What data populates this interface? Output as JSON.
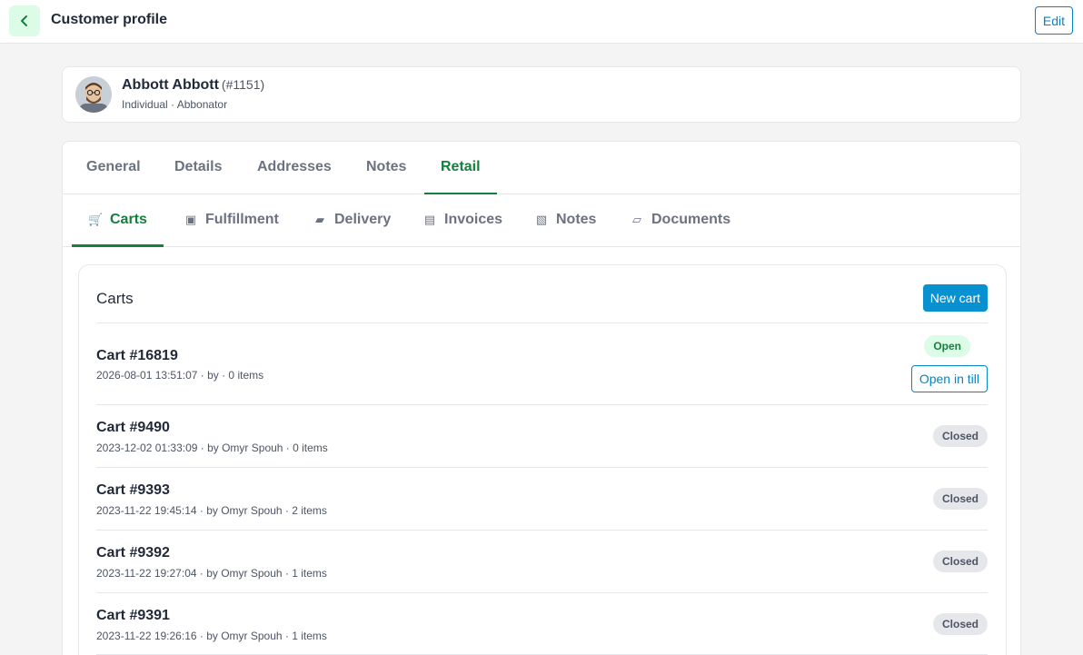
{
  "header": {
    "title": "Customer profile",
    "edit_label": "Edit"
  },
  "profile": {
    "name": "Abbott Abbott",
    "id": "(#1151)",
    "subtitle": "Individual · Abbonator"
  },
  "main_tabs": [
    "General",
    "Details",
    "Addresses",
    "Notes",
    "Retail"
  ],
  "active_main_tab": "Retail",
  "sub_tabs": [
    {
      "label": "Carts",
      "icon": "cart-icon"
    },
    {
      "label": "Fulfillment",
      "icon": "fulfillment-icon"
    },
    {
      "label": "Delivery",
      "icon": "delivery-icon"
    },
    {
      "label": "Invoices",
      "icon": "invoices-icon"
    },
    {
      "label": "Notes",
      "icon": "notes-icon"
    },
    {
      "label": "Documents",
      "icon": "documents-icon"
    }
  ],
  "active_sub_tab": "Carts",
  "carts": {
    "title": "Carts",
    "new_cart_label": "New cart",
    "open_in_till_label": "Open in till",
    "items": [
      {
        "name": "Cart #16819",
        "meta": "2026-08-01 13:51:07 · by · 0 items",
        "status": "Open"
      },
      {
        "name": "Cart #9490",
        "meta": "2023-12-02 01:33:09 · by Omyr Spouh · 0 items",
        "status": "Closed"
      },
      {
        "name": "Cart #9393",
        "meta": "2023-11-22 19:45:14 · by Omyr Spouh · 2 items",
        "status": "Closed"
      },
      {
        "name": "Cart #9392",
        "meta": "2023-11-22 19:27:04 · by Omyr Spouh · 1 items",
        "status": "Closed"
      },
      {
        "name": "Cart #9391",
        "meta": "2023-11-22 19:26:16 · by Omyr Spouh · 1 items",
        "status": "Closed"
      }
    ]
  },
  "colors": {
    "accent_green": "#15803d",
    "accent_blue": "#0891d1",
    "open_badge_bg": "#dcfce7",
    "closed_badge_bg": "#e5e7eb"
  }
}
